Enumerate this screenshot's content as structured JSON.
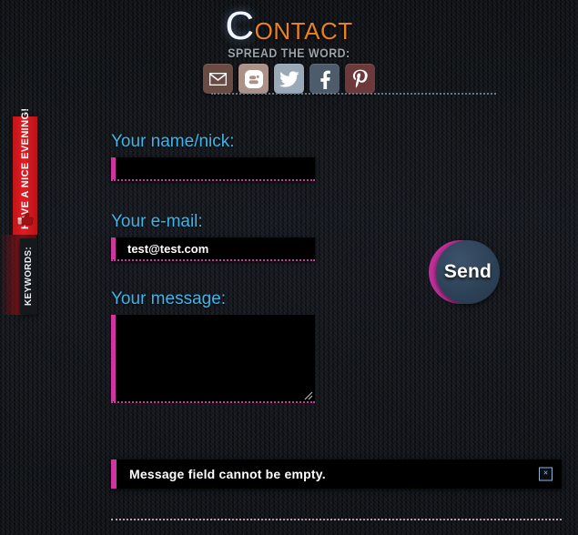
{
  "header": {
    "title_cap": "C",
    "title_rest": "ontact",
    "subtitle": "Spread the word:"
  },
  "social": [
    {
      "name": "email-icon",
      "label": "Email",
      "color": "#6a4b44"
    },
    {
      "name": "blogger-icon",
      "label": "Blogger",
      "color": "#ab9186"
    },
    {
      "name": "twitter-icon",
      "label": "Twitter",
      "color": "#9aa9b8"
    },
    {
      "name": "facebook-icon",
      "label": "Facebook",
      "color": "#4e5b6b"
    },
    {
      "name": "pinterest-icon",
      "label": "Pinterest",
      "color": "#6d3a3c"
    }
  ],
  "side_tabs": {
    "evening": {
      "label": "Have a nice evening!",
      "color": "#e21c22",
      "icon": "thumbs-up-icon"
    },
    "keywords": {
      "label": "Keywords:",
      "color": "#15181d"
    }
  },
  "form": {
    "name": {
      "label": "Your name/nick:",
      "value": "",
      "placeholder": ""
    },
    "email": {
      "label": "Your e-mail:",
      "value": "test@test.com",
      "placeholder": ""
    },
    "message": {
      "label": "Your message:",
      "value": "",
      "placeholder": ""
    },
    "send_label": "Send"
  },
  "error": {
    "message": "Message field cannot be empty.",
    "close_label": "×",
    "accent": "#cf35a0"
  },
  "colors": {
    "accent_magenta": "#cf35a0",
    "label_blue": "#3fb4e8",
    "title_orange": "#e8811f",
    "tab_red": "#e21c22",
    "send_disc": "#2e4257"
  }
}
